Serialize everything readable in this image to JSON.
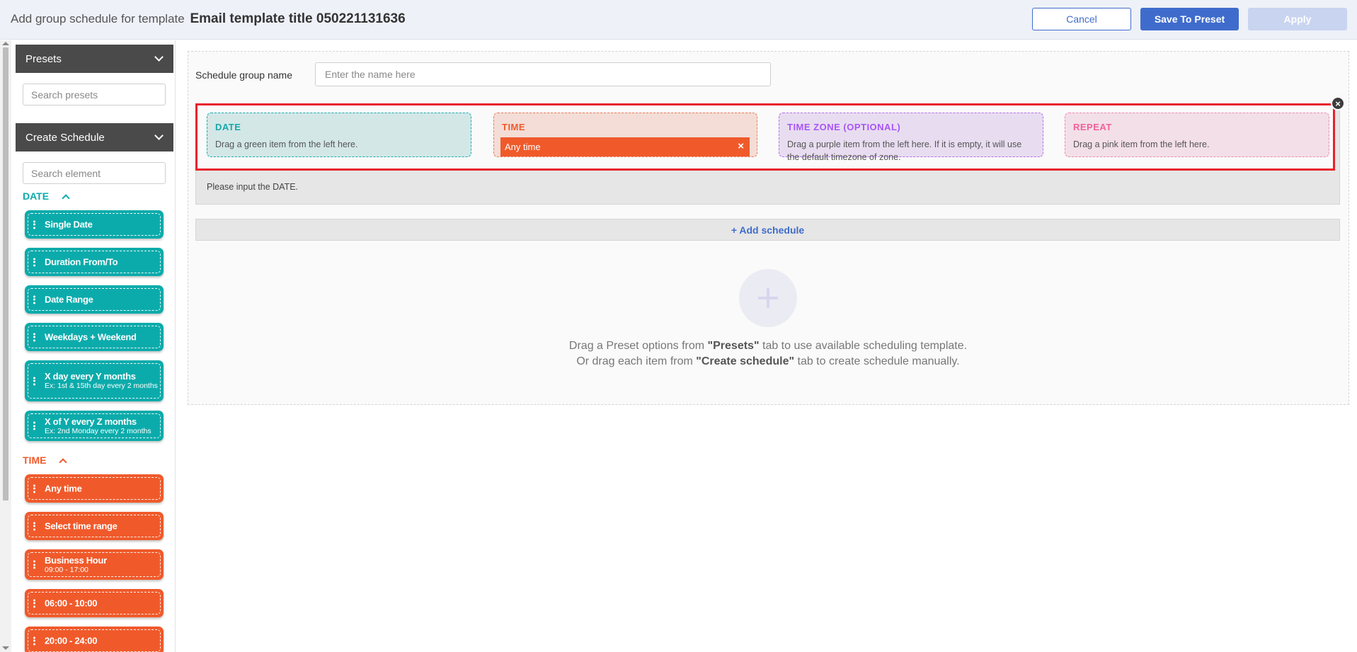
{
  "header": {
    "title_prefix": "Add group schedule for template",
    "title_name": "Email template title 050221131636",
    "cancel_label": "Cancel",
    "save_label": "Save To Preset",
    "apply_label": "Apply"
  },
  "sidebar": {
    "presets_label": "Presets",
    "presets_search_placeholder": "Search presets",
    "create_label": "Create Schedule",
    "element_search_placeholder": "Search element",
    "date_section": "DATE",
    "date_items": [
      {
        "title": "Single Date",
        "sub": ""
      },
      {
        "title": "Duration From/To",
        "sub": ""
      },
      {
        "title": "Date Range",
        "sub": ""
      },
      {
        "title": "Weekdays + Weekend",
        "sub": ""
      },
      {
        "title": "X day every Y months",
        "sub": "Ex: 1st & 15th day every 2 months"
      },
      {
        "title": "X of Y every Z months",
        "sub": "Ex: 2nd Monday every 2 months"
      }
    ],
    "time_section": "TIME",
    "time_items": [
      {
        "title": "Any time",
        "sub": ""
      },
      {
        "title": "Select time range",
        "sub": ""
      },
      {
        "title": "Business Hour",
        "sub": "09:00 - 17:00"
      },
      {
        "title": "06:00 - 10:00",
        "sub": ""
      },
      {
        "title": "20:00 - 24:00",
        "sub": ""
      }
    ]
  },
  "main": {
    "group_name_label": "Schedule group name",
    "group_name_placeholder": "Enter the name here",
    "slots": {
      "date_title": "DATE",
      "date_desc": "Drag a green item from the left here.",
      "time_title": "TIME",
      "time_value": "Any time",
      "tz_title": "TIME ZONE (OPTIONAL)",
      "tz_desc": "Drag a purple item from the left here. If it is empty, it will use the default timezone of zone.",
      "repeat_title": "REPEAT",
      "repeat_desc": "Drag a pink item from the left here."
    },
    "validation_msg": "Please input the DATE.",
    "add_schedule_label": "+ Add schedule",
    "hint": {
      "line1_a": "Drag a Preset options from ",
      "line1_b": "\"Presets\"",
      "line1_c": " tab to use available scheduling template.",
      "line2_a": "Or drag each item from ",
      "line2_b": "\"Create schedule\"",
      "line2_c": " tab to create schedule manually."
    }
  },
  "colors": {
    "accent_blue": "#3f6ccc",
    "date_green": "#0cabab",
    "time_orange": "#f05a2b",
    "tz_purple": "#a855f7",
    "repeat_pink": "#f0609a",
    "highlight_red": "#e8212c"
  }
}
